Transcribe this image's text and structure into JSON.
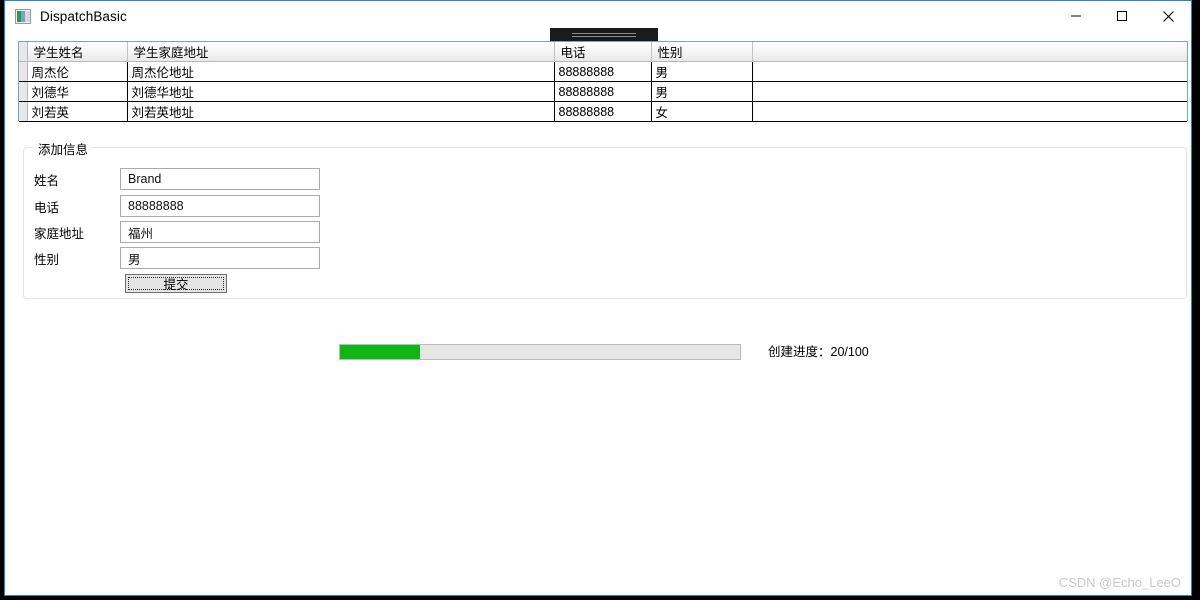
{
  "window": {
    "title": "DispatchBasic",
    "icon": "app-window-icon",
    "controls": {
      "minimize": "—",
      "maximize": "□",
      "close": "✕"
    },
    "border_color": "#2a7fd4"
  },
  "grid": {
    "columns": [
      "学生姓名",
      "学生家庭地址",
      "电话",
      "性别",
      ""
    ],
    "rows": [
      {
        "name": "周杰伦",
        "address": "周杰伦地址",
        "phone": "88888888",
        "gender": "男",
        "extra": ""
      },
      {
        "name": "刘德华",
        "address": "刘德华地址",
        "phone": "88888888",
        "gender": "男",
        "extra": ""
      },
      {
        "name": "刘若英",
        "address": "刘若英地址",
        "phone": "88888888",
        "gender": "女",
        "extra": ""
      }
    ]
  },
  "form": {
    "legend": "添加信息",
    "fields": [
      {
        "label": "姓名",
        "value": "Brand",
        "placeholder": ""
      },
      {
        "label": "电话",
        "value": "88888888",
        "placeholder": ""
      },
      {
        "label": "家庭地址",
        "value": "福州",
        "placeholder": ""
      },
      {
        "label": "性别",
        "value": "男",
        "placeholder": ""
      }
    ],
    "submit_label": "提交"
  },
  "progress": {
    "value": 20,
    "max": 100,
    "percent_text": "20%",
    "fill_width": "20%",
    "label": "创建进度：20/100",
    "fill_color": "#10b714",
    "track_color": "#e6e6e6"
  },
  "watermark": {
    "text": "CSDN @Echo_LeeO"
  }
}
